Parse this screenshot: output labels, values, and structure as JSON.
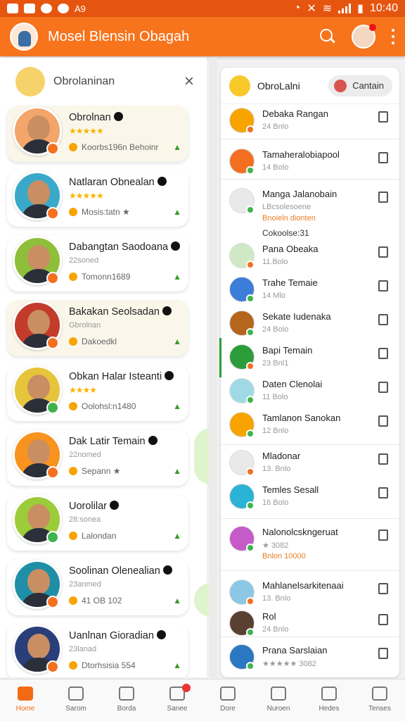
{
  "status_bar": {
    "time": "10:40",
    "left_text": "A9"
  },
  "app_bar": {
    "title": "Mosel Blensin Obagah"
  },
  "left_panel": {
    "header_label": "Obrolaninan",
    "close_symbol": "×",
    "cards": [
      {
        "name": "Obrolnan",
        "stars": "★★★★★",
        "meta": "Koorbs196n Behoinr",
        "dot_color": "#f37021",
        "warm": true
      },
      {
        "name": "Natlaran Obnealan",
        "stars": "★★★★★",
        "meta": "Mosis:tatn ★",
        "dot_color": "#f37021",
        "warm": false
      },
      {
        "name": "Dabangtan Saodoana",
        "sub": "22soned",
        "meta": "Tomonn1689",
        "dot_color": "#f37021",
        "warm": false
      },
      {
        "name": "Bakakan Seolsadan",
        "sub": "Gbrolnan",
        "meta": "Dakoedkl",
        "dot_color": "#f37021",
        "warm": true
      },
      {
        "name": "Obkan Halar Isteanti",
        "stars": "★★★★",
        "meta": "Oolohsl:n1480",
        "dot_color": "#3fb34f",
        "warm": false
      },
      {
        "name": "Dak Latir Temain",
        "sub": "22nomed",
        "meta": "Sepann ★",
        "dot_color": "#f37021",
        "warm": false
      },
      {
        "name": "Uorolilar",
        "sub": "28:sonea",
        "meta": "Lalondan",
        "dot_color": "#3fb34f",
        "warm": false
      },
      {
        "name": "Soolinan Olenealian",
        "sub": "23anmed",
        "meta": "41 OB 102",
        "dot_color": "#f37021",
        "warm": false
      },
      {
        "name": "Uanlnan Gioradian",
        "sub": "23lanad",
        "meta": "Dtorhsisia 554",
        "dot_color": "#f37021",
        "warm": false
      }
    ]
  },
  "right_panel": {
    "header_label": "ObroLalni",
    "header_button": "Cantain",
    "section_label": "Cokoolse:31",
    "rows": [
      {
        "name": "Debaka Rangan",
        "sub": "24 Bnlo",
        "avatar_color": "#f7a400"
      },
      {
        "name": "Tamaheralobiapool",
        "sub": "14 Bolo",
        "avatar_color": "#f37021"
      },
      {
        "name": "Manga Jalanobain",
        "sub": "LBcsolesoene",
        "extra": "Bnoieln dionten",
        "avatar_color": "#e9e9e9"
      },
      {
        "name": "Pana Obeaka",
        "sub": "11.Bolo",
        "avatar_color": "#cfe9c5"
      },
      {
        "name": "Trahe Temaie",
        "sub": "14 Mlo",
        "avatar_color": "#3b7dd8"
      },
      {
        "name": "Sekate Iudenaka",
        "sub": "24 Bolo",
        "avatar_color": "#b5651d"
      },
      {
        "name": "Bapi Temain",
        "sub": "23 Bnl1",
        "avatar_color": "#2d9d3b"
      },
      {
        "name": "Daten Clenolai",
        "sub": "11 Bolo",
        "avatar_color": "#9fd9e6"
      },
      {
        "name": "Tamlanon Sanokan",
        "sub": "12 Bnlo",
        "avatar_color": "#f7a400"
      },
      {
        "name": "Mladonar",
        "sub": "13. Bnlo",
        "avatar_color": "#e9e9e9"
      },
      {
        "name": "Temles Sesall",
        "sub": "16 Bolo",
        "avatar_color": "#2bb3d6"
      },
      {
        "name": "Nalonolcskngeruat",
        "sub": "★ 3082",
        "extra": "Bnlon 10000",
        "avatar_color": "#c45bc7"
      },
      {
        "name": "Mahlanelsarkitenaai",
        "sub": "13. Bnlo",
        "avatar_color": "#8cc8e6"
      },
      {
        "name": "Rol",
        "sub": "24 Bnlo",
        "avatar_color": "#5a4030"
      },
      {
        "name": "Prana Sarslaian",
        "sub": "★★★★★ 3082",
        "avatar_color": "#2b78c2"
      }
    ]
  },
  "bottom_nav": [
    {
      "label": "Home",
      "active": true
    },
    {
      "label": "Sarom",
      "active": false
    },
    {
      "label": "Borda",
      "active": false
    },
    {
      "label": "Sanee",
      "active": false,
      "notify": true
    },
    {
      "label": "Dore",
      "active": false
    },
    {
      "label": "Nuroen",
      "active": false
    },
    {
      "label": "Hedes",
      "active": false
    },
    {
      "label": "Tenses",
      "active": false
    }
  ]
}
